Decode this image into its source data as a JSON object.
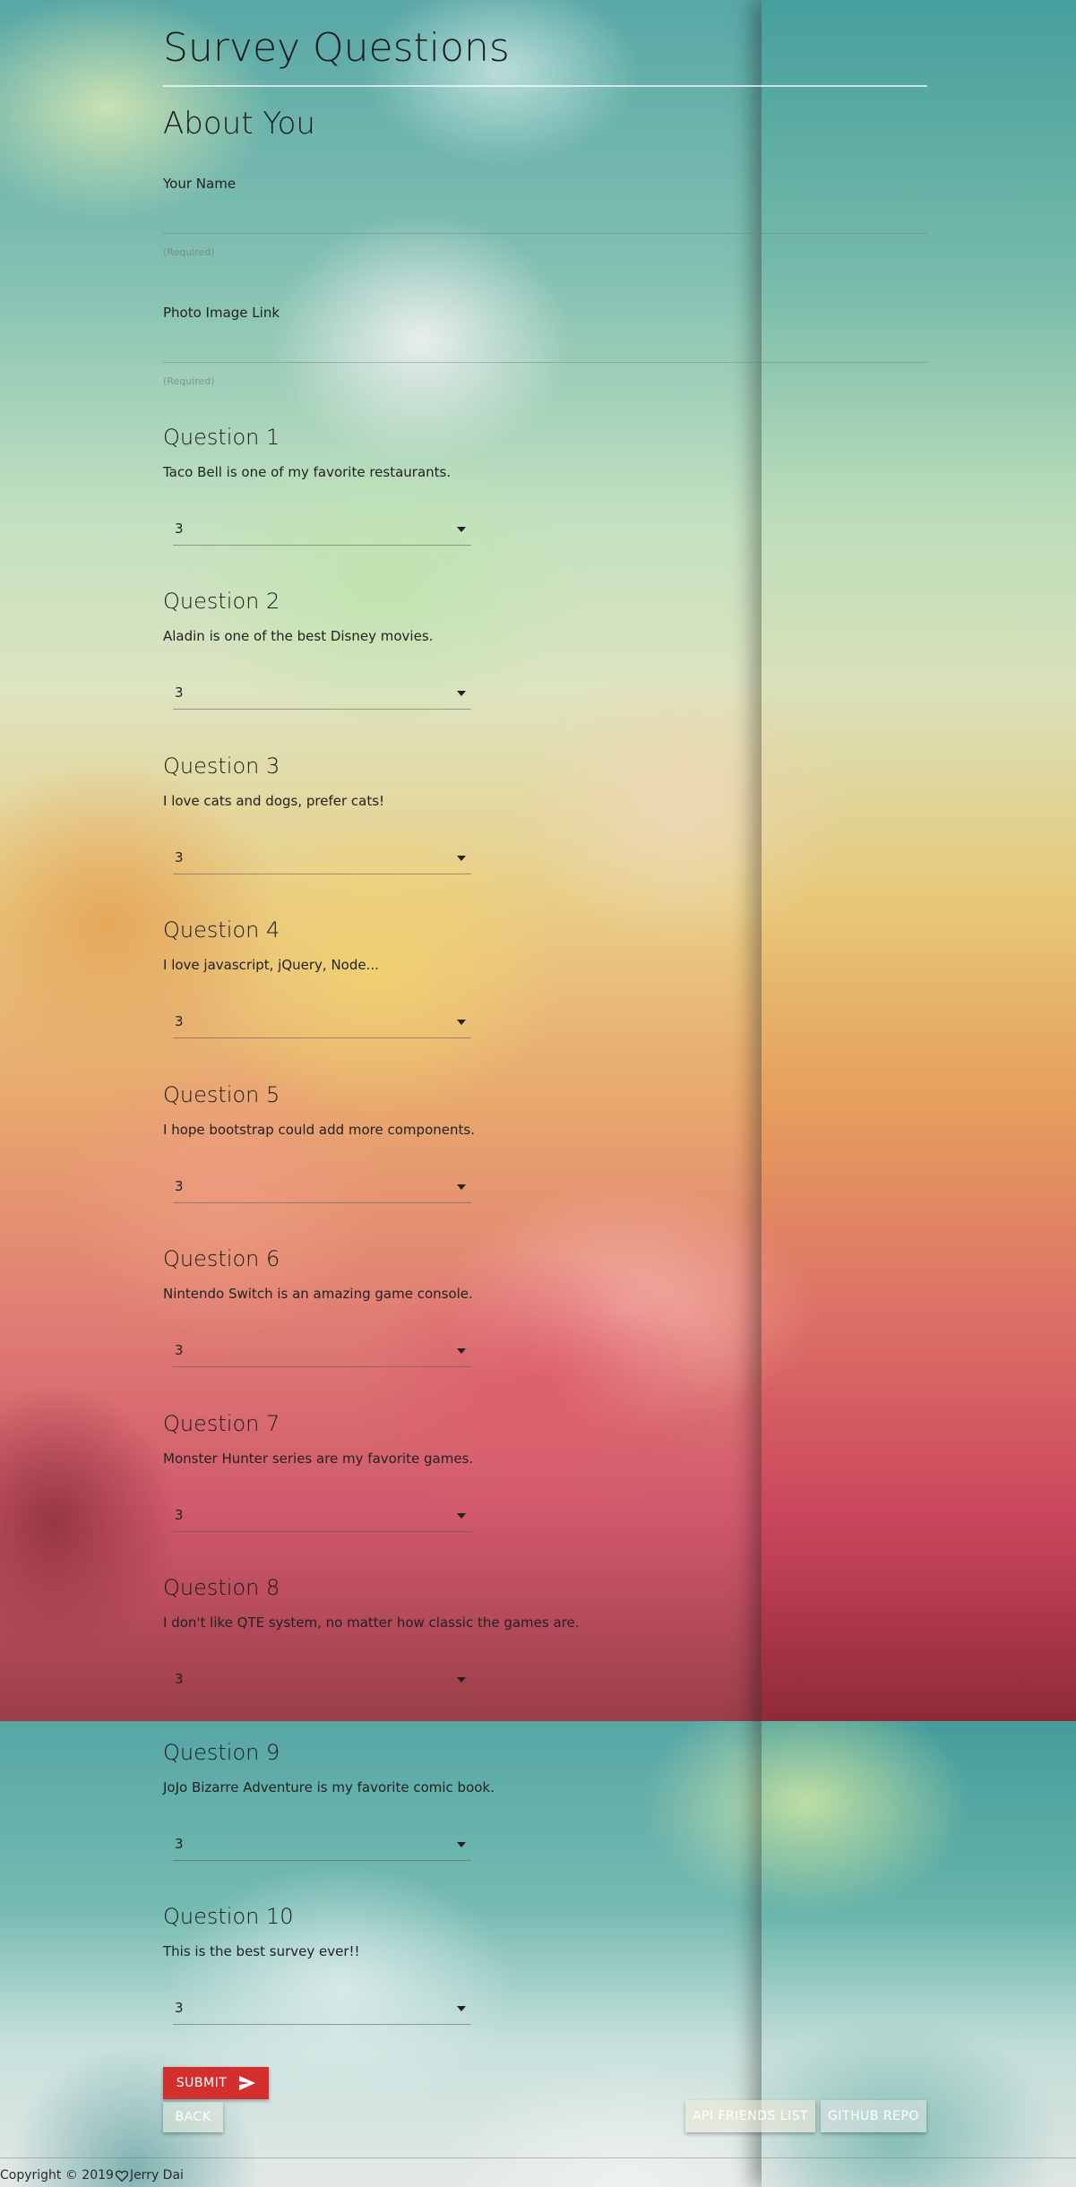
{
  "header": {
    "title": "Survey Questions"
  },
  "about": {
    "section_title": "About You",
    "name": {
      "label": "Your Name",
      "value": "",
      "hint": "(Required)"
    },
    "photo": {
      "label": "Photo Image Link",
      "value": "",
      "hint": "(Required)"
    }
  },
  "questions": [
    {
      "title": "Question 1",
      "text": "Taco Bell is one of my favorite restaurants.",
      "value": "3"
    },
    {
      "title": "Question 2",
      "text": "Aladin is one of the best Disney movies.",
      "value": "3"
    },
    {
      "title": "Question 3",
      "text": "I love cats and dogs, prefer cats!",
      "value": "3"
    },
    {
      "title": "Question 4",
      "text": "I love javascript, jQuery, Node...",
      "value": "3"
    },
    {
      "title": "Question 5",
      "text": "I hope bootstrap could add more components.",
      "value": "3"
    },
    {
      "title": "Question 6",
      "text": "Nintendo Switch is an amazing game console.",
      "value": "3"
    },
    {
      "title": "Question 7",
      "text": "Monster Hunter series are my favorite games.",
      "value": "3"
    },
    {
      "title": "Question 8",
      "text": "I don't like QTE system, no matter how classic the games are.",
      "value": "3"
    },
    {
      "title": "Question 9",
      "text": "JoJo Bizarre Adventure is my favorite comic book.",
      "value": "3"
    },
    {
      "title": "Question 10",
      "text": "This is the best survey ever!!",
      "value": "3"
    }
  ],
  "buttons": {
    "submit": "SUBMIT",
    "back": "BACK",
    "api_friends": "API FRIENDS LIST",
    "github": "GITHUB REPO"
  },
  "footer": {
    "prefix": "Copyright © 2019",
    "author": "Jerry Dai"
  },
  "icons": {
    "submit": "send-icon",
    "heart": "heart-icon",
    "select": "chevron-down-icon"
  },
  "colors": {
    "submit_bg": "#d32f2f"
  }
}
